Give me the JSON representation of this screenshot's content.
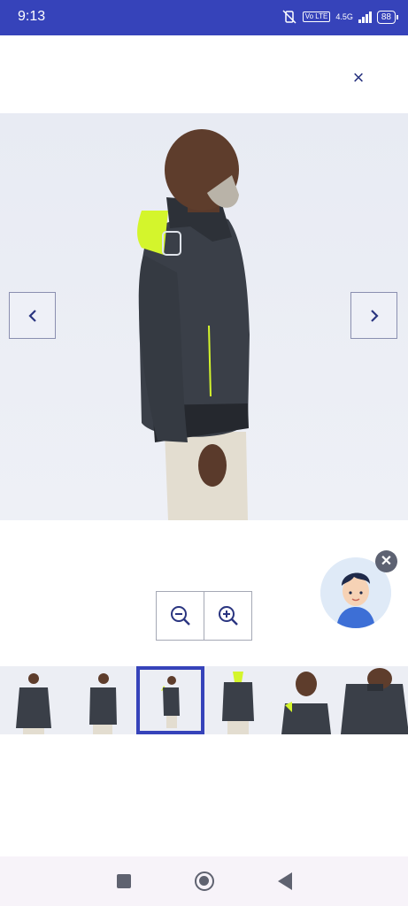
{
  "status_bar": {
    "time": "9:13",
    "volte": "Vo LTE",
    "network": "4.5G",
    "battery": "88"
  },
  "viewer": {
    "close_symbol": "×",
    "prev_icon": "chevron-left-icon",
    "next_icon": "chevron-right-icon",
    "zoom_out_icon": "zoom-out-icon",
    "zoom_in_icon": "zoom-in-icon"
  },
  "assistant": {
    "close_symbol": "✕"
  },
  "thumbnails": [
    {
      "view": "front"
    },
    {
      "view": "front-angle"
    },
    {
      "view": "side",
      "selected": true
    },
    {
      "view": "back"
    },
    {
      "view": "collar-closeup"
    },
    {
      "view": "hood-detail"
    }
  ],
  "colors": {
    "brand": "#3643ba",
    "jacket": "#3a3f48",
    "accent": "#d4f52c"
  }
}
